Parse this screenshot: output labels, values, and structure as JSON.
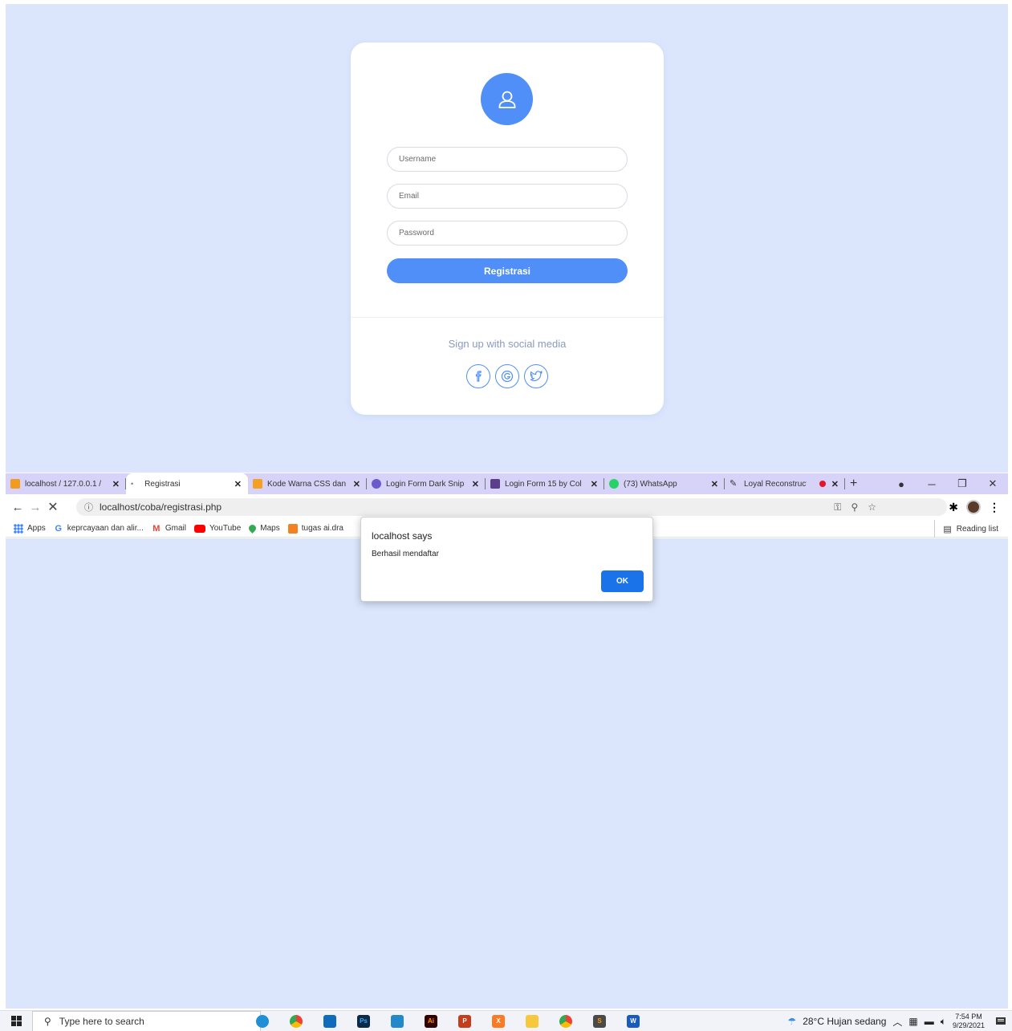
{
  "form": {
    "username_placeholder": "Username",
    "email_placeholder": "Email",
    "password_placeholder": "Password",
    "submit_label": "Registrasi",
    "social_title": "Sign up with social media"
  },
  "browser": {
    "tabs": [
      {
        "label": "localhost / 127.0.0.1 / ",
        "favicon_color": "#f29b1d"
      },
      {
        "label": "Registrasi",
        "favicon_color": "#777777"
      },
      {
        "label": "Kode Warna CSS dan ",
        "favicon_color": "#f4a020"
      },
      {
        "label": "Login Form Dark Snip",
        "favicon_color": "#6a5acd"
      },
      {
        "label": "Login Form 15 by Col",
        "favicon_color": "#5b3e8c"
      },
      {
        "label": "(73) WhatsApp",
        "favicon_color": "#25d366"
      },
      {
        "label": "Loyal Reconstruct",
        "favicon_color": "#333333"
      }
    ],
    "close_glyph": "✕",
    "new_tab_glyph": "+",
    "url": "localhost/coba/registrasi.php",
    "reading_list": "Reading list",
    "bookmarks": [
      {
        "label": "Apps"
      },
      {
        "label": "keprcayaan dan alir..."
      },
      {
        "label": "Gmail"
      },
      {
        "label": "YouTube"
      },
      {
        "label": "Maps"
      },
      {
        "label": "tugas ai.dra"
      }
    ]
  },
  "dialog": {
    "title": "localhost says",
    "message": "Berhasil mendaftar",
    "ok_label": "OK"
  },
  "taskbar": {
    "search_placeholder": "Type here to search",
    "weather": "28°C  Hujan sedang",
    "time": "7:54 PM",
    "date": "9/29/2021"
  },
  "colors": {
    "accent": "#4f8ff7",
    "page_bg": "#dbe6fd",
    "tabbar_bg": "#d7d2f7",
    "dialog_ok": "#1a73e8"
  }
}
